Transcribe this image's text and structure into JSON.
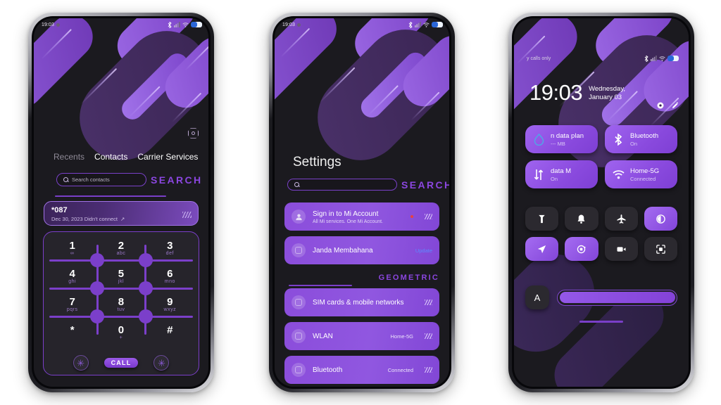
{
  "theme": {
    "name": "GEOMETRIC",
    "accent": "#8b46e0",
    "accent_light": "#9f64ef",
    "card_purple": "#8b4ddb",
    "screen_bg": "#1b1a1f",
    "tile_dark": "#2b292f"
  },
  "phone1": {
    "statusbar": {
      "time": "19:03",
      "icons": [
        "bluetooth-icon",
        "signal-icon",
        "wifi-icon",
        "battery-icon"
      ]
    },
    "gear_icon": "settings-gear-icon",
    "tabs": [
      {
        "label": "Recents",
        "active": false
      },
      {
        "label": "Contacts",
        "active": true
      },
      {
        "label": "Carrier Services",
        "active": false
      }
    ],
    "search": {
      "placeholder": "Search contacts",
      "word": "SEARCH"
    },
    "recent_call": {
      "number": "*087",
      "detail": "Dec 30, 2023 Didn't connect",
      "arrow": "↗"
    },
    "keypad": [
      {
        "digit": "1",
        "letters": "∞"
      },
      {
        "digit": "2",
        "letters": "abc"
      },
      {
        "digit": "3",
        "letters": "def"
      },
      {
        "digit": "4",
        "letters": "ghi"
      },
      {
        "digit": "5",
        "letters": "jkl"
      },
      {
        "digit": "6",
        "letters": "mno"
      },
      {
        "digit": "7",
        "letters": "pqrs"
      },
      {
        "digit": "8",
        "letters": "tuv"
      },
      {
        "digit": "9",
        "letters": "wxyz"
      },
      {
        "digit": "*",
        "letters": ""
      },
      {
        "digit": "0",
        "letters": "+"
      },
      {
        "digit": "#",
        "letters": ""
      }
    ],
    "actions": {
      "left": "✳",
      "call": "CALL",
      "right": "✳"
    }
  },
  "phone2": {
    "statusbar": {
      "time": "19:03"
    },
    "title": "Settings",
    "search": {
      "placeholder": "",
      "word": "SEARCH"
    },
    "account_card": {
      "title": "Sign in to Mi Account",
      "subtitle": "All Mi services. One Mi Account.",
      "icon": "person-icon"
    },
    "update_card": {
      "title": "Janda Membahana",
      "badge": "Update",
      "icon": "square-icon"
    },
    "section_label": "GEOMETRIC",
    "items": [
      {
        "title": "SIM cards & mobile networks",
        "value": "",
        "icon": "sim-icon"
      },
      {
        "title": "WLAN",
        "value": "Home-5G",
        "icon": "wifi-icon"
      },
      {
        "title": "Bluetooth",
        "value": "Connected",
        "icon": "bluetooth-icon"
      }
    ]
  },
  "phone3": {
    "statusbar": {
      "carrier": "y calls only"
    },
    "clock": "19:03",
    "date": "Wednesday, January 03",
    "header_icons": [
      "settings-icon",
      "edit-pencil-icon"
    ],
    "big_tiles": [
      {
        "label": "n data plan",
        "sub": "--- MB",
        "icon": "data-drop-icon",
        "on": true
      },
      {
        "label": "Bluetooth",
        "sub": "On",
        "icon": "bluetooth-icon",
        "on": true
      },
      {
        "label": "data   M",
        "sub": "On",
        "icon": "mobile-data-icon",
        "on": true
      },
      {
        "label": "Home-5G",
        "sub": "Connected",
        "icon": "wifi-icon",
        "on": true
      }
    ],
    "small_tiles": [
      {
        "icon": "flashlight-icon",
        "on": false
      },
      {
        "icon": "bell-icon",
        "on": false
      },
      {
        "icon": "airplane-icon",
        "on": false
      },
      {
        "icon": "dark-mode-icon",
        "on": true
      },
      {
        "icon": "location-icon",
        "on": true
      },
      {
        "icon": "auto-rotate-icon",
        "on": true
      },
      {
        "icon": "screen-record-icon",
        "on": false
      },
      {
        "icon": "scan-icon",
        "on": false
      }
    ],
    "auto_brightness": {
      "label": "A"
    },
    "brightness": {
      "value": 100
    }
  }
}
